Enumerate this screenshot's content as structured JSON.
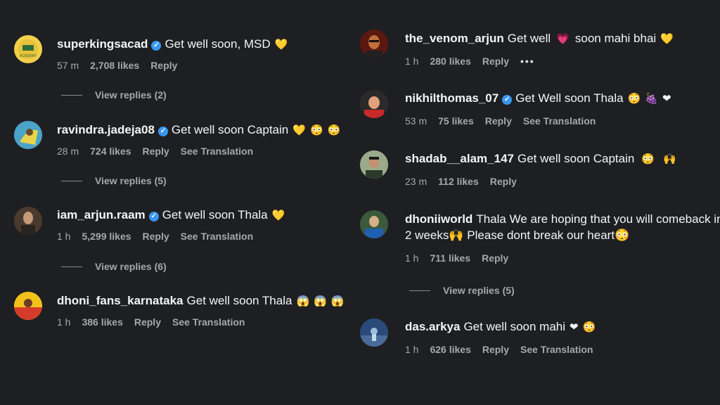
{
  "left": [
    {
      "user": "superkingsacad",
      "verified": true,
      "text": "Get well soon, MSD",
      "emojis": [
        "💛"
      ],
      "time": "57 m",
      "likes": "2,708 likes",
      "reply": "Reply",
      "translation": "",
      "view_replies": "View replies (2)",
      "avatar": {
        "bg": "#f3d04a",
        "fg": "#2f6f3a"
      }
    },
    {
      "user": "ravindra.jadeja08",
      "verified": true,
      "text": "Get well soon Captain",
      "emojis": [
        "💛",
        "😳",
        "😳"
      ],
      "time": "28 m",
      "likes": "724 likes",
      "reply": "Reply",
      "translation": "See Translation",
      "view_replies": "View replies (5)",
      "avatar": {
        "bg": "#4aa3c8",
        "fg": "#e8d34a"
      }
    },
    {
      "user": "iam_arjun.raam",
      "verified": true,
      "text": "Get well soon Thala",
      "emojis": [
        "💛"
      ],
      "time": "1 h",
      "likes": "5,299 likes",
      "reply": "Reply",
      "translation": "See Translation",
      "view_replies": "View replies (6)",
      "avatar": {
        "bg": "#5a4a3a",
        "fg": "#c49a78"
      }
    },
    {
      "user": "dhoni_fans_karnataka",
      "verified": false,
      "text": "Get well soon Thala",
      "emojis": [
        "😱",
        "😱",
        "😱"
      ],
      "time": "1 h",
      "likes": "386 likes",
      "reply": "Reply",
      "translation": "See Translation",
      "view_replies": "",
      "avatar": {
        "bg": "#f2c21b",
        "fg": "#d63a2a"
      }
    }
  ],
  "right": [
    {
      "user": "the_venom_arjun",
      "verified": false,
      "text": "Get well",
      "emojis": [
        "💗"
      ],
      "text2": "soon mahi bhai",
      "emojis2": [
        "💛"
      ],
      "time": "1 h",
      "likes": "280 likes",
      "reply": "Reply",
      "translation": "",
      "more": "•••",
      "view_replies": "",
      "avatar": {
        "bg": "#6a1e14",
        "fg": "#c0703a"
      }
    },
    {
      "user": "nikhilthomas_07",
      "verified": true,
      "text": "Get Well soon Thala",
      "emojis": [
        "😳",
        "🍇",
        "❤"
      ],
      "time": "53 m",
      "likes": "75 likes",
      "reply": "Reply",
      "translation": "See Translation",
      "view_replies": "",
      "avatar": {
        "bg": "#c82a2a",
        "fg": "#e0a27a"
      }
    },
    {
      "user": "shadab__alam_147",
      "verified": false,
      "text": "Get well soon Captain",
      "emojis": [
        "😳",
        "🙌"
      ],
      "time": "23 m",
      "likes": "112 likes",
      "reply": "Reply",
      "translation": "",
      "view_replies": "",
      "avatar": {
        "bg": "#8a9a7a",
        "fg": "#2a3a2a"
      }
    },
    {
      "user": "dhoniiworld",
      "verified": false,
      "text": "Thala We are hoping that you will comeback in",
      "text_line2": "2 weeks🙌 Please dont break our heart😳",
      "emojis": [],
      "time": "1 h",
      "likes": "711 likes",
      "reply": "Reply",
      "translation": "",
      "view_replies": "View replies (5)",
      "avatar": {
        "bg": "#1f5fb0",
        "fg": "#d8b08a"
      }
    },
    {
      "user": "das.arkya",
      "verified": false,
      "text": "Get well soon mahi",
      "emojis": [
        "❤",
        "😳"
      ],
      "time": "1 h",
      "likes": "626 likes",
      "reply": "Reply",
      "translation": "See Translation",
      "view_replies": "",
      "avatar": {
        "bg": "#2a4a7a",
        "fg": "#9ac0e0"
      }
    }
  ],
  "colors": {
    "bg": "#1e1f22",
    "meta": "#a8a8a8",
    "verified": "#3897f0"
  }
}
